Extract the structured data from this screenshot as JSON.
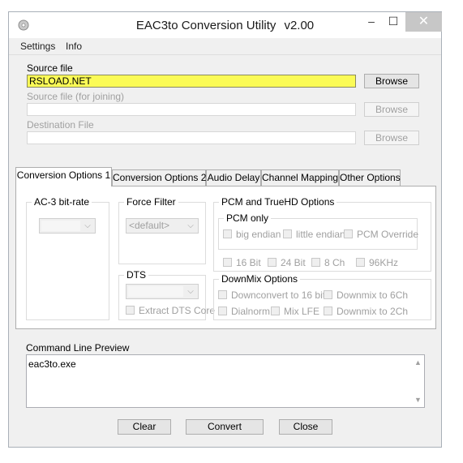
{
  "window": {
    "title": "EAC3to Conversion Utility",
    "version": "v2.00",
    "controls": {
      "minimize": "–",
      "maximize": "☐",
      "close": "✕"
    }
  },
  "menu": {
    "settings": "Settings",
    "info": "Info"
  },
  "source": {
    "label": "Source file",
    "value": "RSLOAD.NET",
    "browse": "Browse"
  },
  "joining": {
    "label": "Source file (for joining)",
    "value": "",
    "browse": "Browse"
  },
  "destination": {
    "label": "Destination File",
    "value": "",
    "browse": "Browse"
  },
  "tabs": [
    "Conversion Options 1",
    "Conversion Options 2",
    "Audio Delay",
    "Channel Mapping",
    "Other Options"
  ],
  "options1": {
    "ac3": {
      "title": "AC-3 bit-rate",
      "value": ""
    },
    "force_filter": {
      "title": "Force Filter",
      "value": "<default>"
    },
    "dts": {
      "title": "DTS",
      "value": "",
      "extract_core": "Extract DTS Core"
    },
    "pcm": {
      "title": "PCM and TrueHD Options",
      "pcm_only": {
        "title": "PCM only",
        "big_endian": "big endian",
        "little_endian": "little endian",
        "pcm_override": "PCM Override"
      },
      "bit16": "16 Bit",
      "bit24": "24 Bit",
      "ch8": "8 Ch",
      "khz96": "96KHz"
    },
    "downmix": {
      "title": "DownMix Options",
      "downconvert16": "Downconvert to 16 bit",
      "downmix6": "Downmix to 6Ch",
      "dialnorm": "Dialnorm",
      "mixlfe": "Mix LFE",
      "downmix2": "Downmix to 2Ch"
    }
  },
  "preview": {
    "label": "Command Line Preview",
    "text": "eac3to.exe"
  },
  "actions": {
    "clear": "Clear",
    "convert": "Convert",
    "close": "Close"
  },
  "colors": {
    "source_highlight": "#fbfb56",
    "close_button": "#c7c7c7"
  }
}
